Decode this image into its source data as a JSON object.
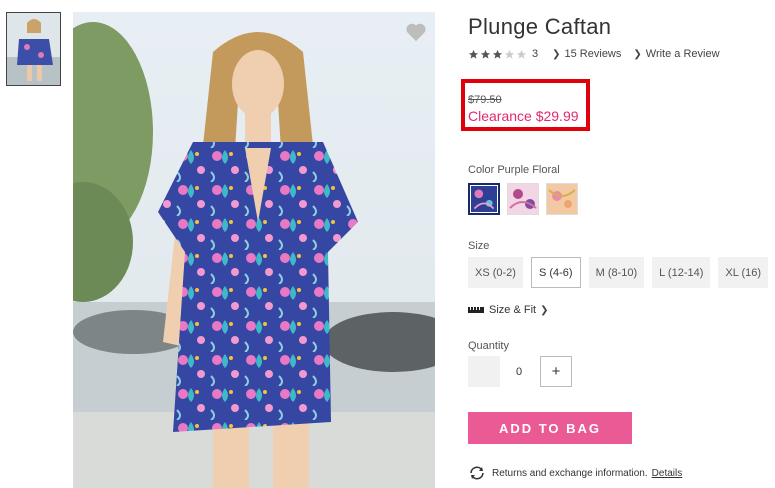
{
  "product": {
    "title": "Plunge Caftan",
    "rating": {
      "stars": 3,
      "max_stars": 5,
      "count": "3"
    },
    "reviews_link": "15 Reviews",
    "write_review_link": "Write a Review",
    "was_price": "$79.50",
    "sale_price": "Clearance $29.99"
  },
  "color": {
    "label": "Color Purple Floral",
    "swatches": [
      "purple-floral",
      "pink-paisley",
      "peach-paisley"
    ],
    "selected": 0
  },
  "size": {
    "label": "Size",
    "options": [
      "XS (0-2)",
      "S (4-6)",
      "M (8-10)",
      "L (12-14)",
      "XL (16)"
    ],
    "selected": 1
  },
  "size_fit": "Size & Fit",
  "quantity": {
    "label": "Quantity",
    "value": "0",
    "plus": "+"
  },
  "add_to_bag": "ADD TO BAG",
  "returns": {
    "text": "Returns and exchange information.",
    "link": "Details"
  },
  "colors": {
    "accent_pink": "#ea5a94",
    "sale_red": "#e4286e",
    "highlight_red": "#e0000a"
  }
}
